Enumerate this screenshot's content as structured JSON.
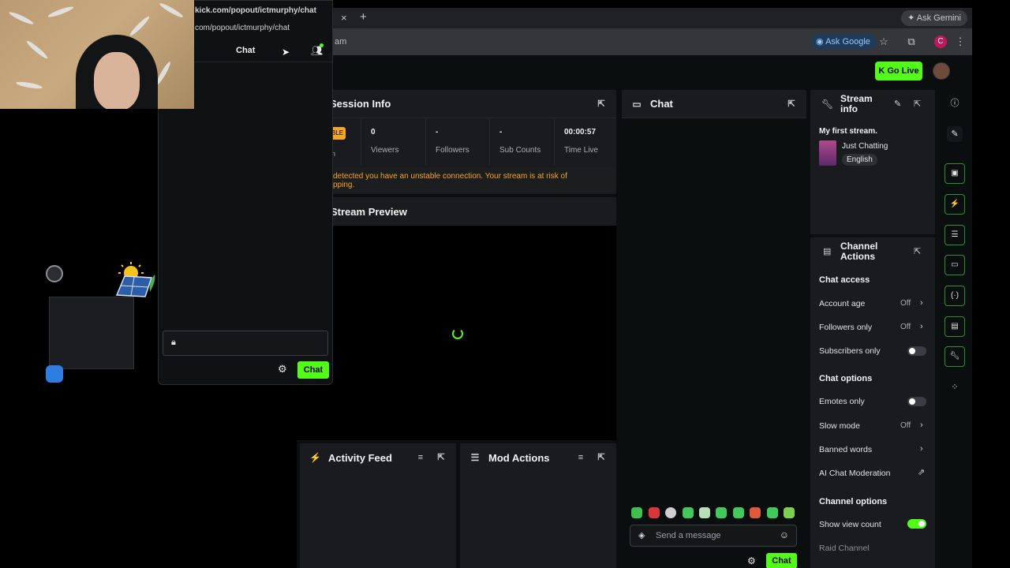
{
  "browser": {
    "tab_close": "×",
    "new_tab": "+",
    "ask_gemini": "Ask Gemini",
    "url_fragment": "am",
    "ask_google": "Ask Google",
    "profile_initial": "C"
  },
  "popout": {
    "url_line1": "kick.com/popout/ictmurphy/chat",
    "url_line2": "com/popout/ictmurphy/chat",
    "title": "Chat",
    "chat_button": "Chat"
  },
  "dashboard": {
    "go_live": "Go Live",
    "session_info": {
      "title": "Session Info",
      "badge": "BLE",
      "badge_sub": "n",
      "stats": [
        {
          "value": "0",
          "label": "Viewers"
        },
        {
          "value": "-",
          "label": "Followers"
        },
        {
          "value": "-",
          "label": "Sub Counts"
        },
        {
          "value": "00:00:57",
          "label": "Time Live"
        }
      ],
      "warning_line1": "detected you have an unstable connection. Your stream is at risk of",
      "warning_line2": "pping."
    },
    "stream_preview": {
      "title": "Stream Preview"
    },
    "activity_feed": {
      "title": "Activity Feed"
    },
    "mod_actions": {
      "title": "Mod Actions"
    },
    "chat": {
      "title": "Chat",
      "placeholder": "Send a message",
      "chat_button": "Chat"
    },
    "stream_info": {
      "title_line1": "Stream",
      "title_line2": "info",
      "stream_title": "My first stream.",
      "category": "Just Chatting",
      "language": "English"
    },
    "channel_actions": {
      "title_line1": "Channel",
      "title_line2": "Actions",
      "chat_access": {
        "heading": "Chat access",
        "account_age": "Account age",
        "account_age_value": "Off",
        "followers_only": "Followers only",
        "followers_only_value": "Off",
        "subscribers_only": "Subscribers only",
        "subscribers_only_on": false
      },
      "chat_options": {
        "heading": "Chat options",
        "emotes_only": "Emotes only",
        "emotes_only_on": false,
        "slow_mode": "Slow mode",
        "slow_mode_value": "Off",
        "banned_words": "Banned words",
        "ai_moderation": "AI Chat Moderation"
      },
      "channel_options": {
        "heading": "Channel options",
        "show_view_count": "Show view count",
        "show_view_count_on": true,
        "raid_channel": "Raid Channel"
      }
    }
  },
  "colors": {
    "brand_green": "#53fc18",
    "warning": "#f5a623",
    "panel": "#191b1f",
    "background": "#0b0e0f"
  }
}
